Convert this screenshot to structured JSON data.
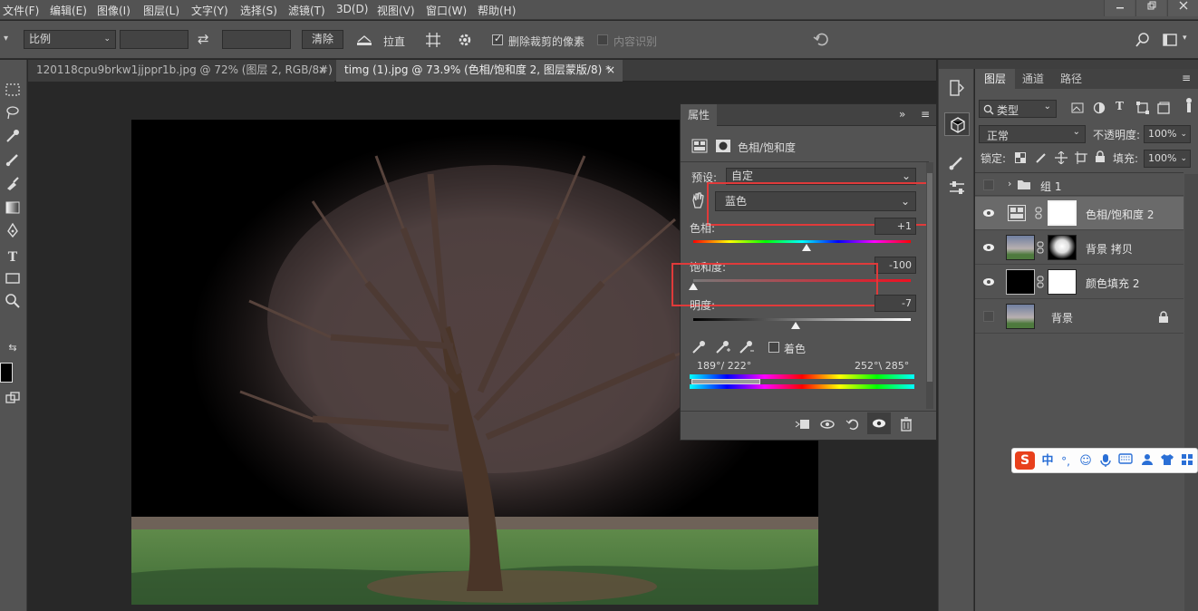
{
  "menu": [
    "文件(F)",
    "编辑(E)",
    "图像(I)",
    "图层(L)",
    "文字(Y)",
    "选择(S)",
    "滤镜(T)",
    "3D(D)",
    "视图(V)",
    "窗口(W)",
    "帮助(H)"
  ],
  "options": {
    "ratio_select": "比例",
    "swap_glyph": "⇄",
    "clear_button": "清除",
    "straighten_label": "拉直",
    "delete_cropped_label": "删除裁剪的像素",
    "content_aware_label": "内容识别",
    "delete_cropped_checked": true,
    "content_aware_checked": false
  },
  "tabs": [
    {
      "label": "120118cpu9brkw1jjppr1b.jpg @ 72% (图层 2, RGB/8#) *",
      "close": "×",
      "active": false
    },
    {
      "label": "timg (1).jpg @ 73.9% (色相/饱和度 2, 图层蒙版/8) *",
      "close": "×",
      "active": true
    }
  ],
  "properties": {
    "tab_label": "属性",
    "collapse_glyph": "»",
    "menu_glyph": "≡",
    "adjustment_title": "色相/饱和度",
    "preset_label": "预设:",
    "preset_value": "自定",
    "channel_value": "蓝色",
    "hue_label": "色相:",
    "hue_value": "+1",
    "hue_level": 0.52,
    "saturation_label": "饱和度:",
    "saturation_value": "-100",
    "saturation_level": 0.0,
    "lightness_label": "明度:",
    "lightness_value": "-7",
    "lightness_level": 0.47,
    "colorize_label": "着色",
    "range_left": "189°/ 222°",
    "range_right": "252°\\ 285°"
  },
  "layers": {
    "tabs": [
      "图层",
      "通道",
      "路径"
    ],
    "filter_kind": "类型",
    "blend_mode": "正常",
    "opacity_label": "不透明度:",
    "opacity_value": "100%",
    "lock_label": "锁定:",
    "fill_label": "填充:",
    "fill_value": "100%",
    "items": [
      {
        "name": "组 1"
      },
      {
        "name": "色相/饱和度 2"
      },
      {
        "name": "背景 拷贝"
      },
      {
        "name": "颜色填充 2"
      },
      {
        "name": "背景"
      }
    ]
  },
  "ime": {
    "logo": "S",
    "lang": "中"
  },
  "colors": {
    "accent_red": "#e03a3a",
    "panel": "#535353",
    "canvas_bg": "#282828"
  }
}
